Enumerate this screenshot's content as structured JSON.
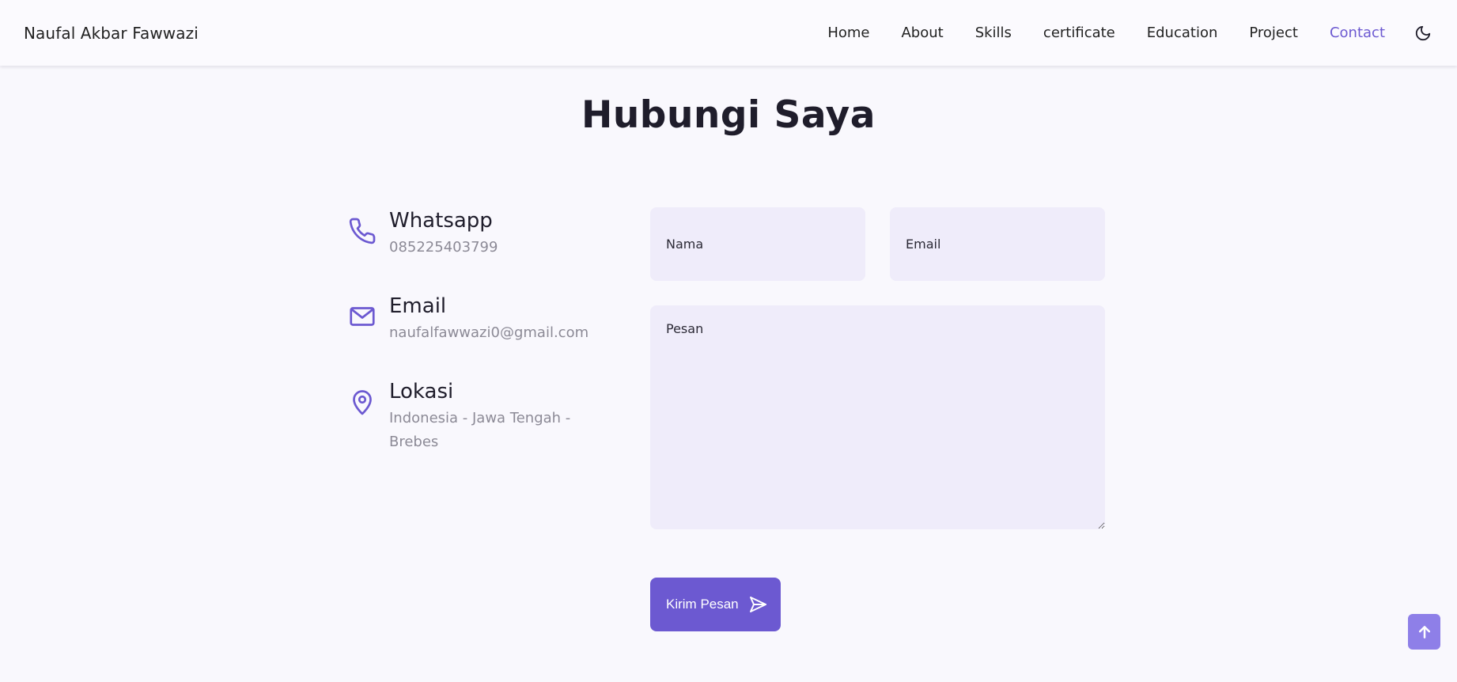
{
  "header": {
    "brand": "Naufal Akbar Fawwazi",
    "nav": [
      "Home",
      "About",
      "Skills",
      "certificate",
      "Education",
      "Project",
      "Contact"
    ],
    "active": "Contact",
    "theme_icon": "moon-icon"
  },
  "page": {
    "title": "Hubungi Saya"
  },
  "contact_info": [
    {
      "icon": "phone-icon",
      "title": "Whatsapp",
      "value": "085225403799"
    },
    {
      "icon": "mail-icon",
      "title": "Email",
      "value": "naufalfawwazi0@gmail.com"
    },
    {
      "icon": "location-pin-icon",
      "title": "Lokasi",
      "value": "Indonesia - Jawa Tengah - Brebes"
    }
  ],
  "form": {
    "name_placeholder": "Nama",
    "email_placeholder": "Email",
    "message_placeholder": "Pesan",
    "submit_label": "Kirim Pesan",
    "submit_icon": "send-icon"
  },
  "scroll_top_icon": "arrow-up-icon",
  "colors": {
    "accent": "#6c59d1",
    "field_bg": "#efecfa",
    "page_bg": "#f9f8fd"
  }
}
